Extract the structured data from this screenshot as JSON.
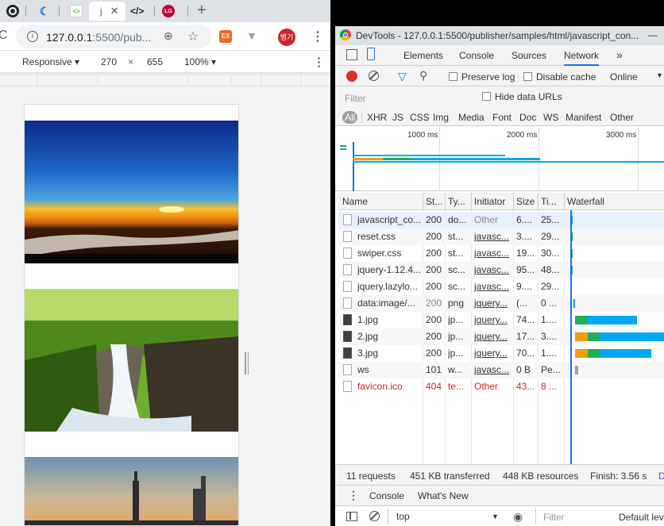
{
  "browser": {
    "tabs": [
      {
        "id": "github",
        "label": ""
      },
      {
        "id": "edge",
        "label": ""
      },
      {
        "id": "code",
        "label": ""
      },
      {
        "id": "active",
        "label": "j"
      },
      {
        "id": "devcode",
        "label": "</>"
      },
      {
        "id": "lg",
        "label": "LG"
      }
    ],
    "url_host": "127.0.0.1",
    "url_rest": ":5500/pub...",
    "profile_label": "병기",
    "ext_label": "EX"
  },
  "device_toolbar": {
    "mode": "Responsive",
    "width": "270",
    "times": "×",
    "height": "655",
    "zoom": "100%"
  },
  "devtools": {
    "title": "DevTools - 127.0.0.1:5500/publisher/samples/html/javascript_con...",
    "tabs": [
      "Elements",
      "Console",
      "Sources",
      "Network"
    ],
    "more": "»",
    "toolbar": {
      "preserve_log": "Preserve log",
      "disable_cache": "Disable cache",
      "throttle": "Online"
    },
    "filter_placeholder": "Filter",
    "hide_data_urls": "Hide data URLs",
    "types": [
      "All",
      "XHR",
      "JS",
      "CSS",
      "Img",
      "Media",
      "Font",
      "Doc",
      "WS",
      "Manifest",
      "Other"
    ],
    "overview_ticks": [
      "1000 ms",
      "2000 ms",
      "3000 ms"
    ],
    "columns": [
      "Name",
      "St...",
      "Ty...",
      "Initiator",
      "Size",
      "Ti...",
      "Waterfall"
    ],
    "rows": [
      {
        "name": "javascript_co...",
        "status": "200",
        "type": "do...",
        "initiator": "Other",
        "size": "6....",
        "time": "25..."
      },
      {
        "name": "reset.css",
        "status": "200",
        "type": "st...",
        "initiator": "javasc...",
        "size": "3....",
        "time": "29..."
      },
      {
        "name": "swiper.css",
        "status": "200",
        "type": "st...",
        "initiator": "javasc...",
        "size": "19...",
        "time": "30..."
      },
      {
        "name": "jquery-1.12.4...",
        "status": "200",
        "type": "sc...",
        "initiator": "javasc...",
        "size": "95...",
        "time": "48..."
      },
      {
        "name": "jquery.lazylo...",
        "status": "200",
        "type": "sc...",
        "initiator": "javasc...",
        "size": "9....",
        "time": "29..."
      },
      {
        "name": "data:image/...",
        "status": "200",
        "type": "png",
        "initiator": "jquery...",
        "size": "(...",
        "time": "0 ..."
      },
      {
        "name": "1.jpg",
        "status": "200",
        "type": "jp...",
        "initiator": "jquery...",
        "size": "74...",
        "time": "1...."
      },
      {
        "name": "2.jpg",
        "status": "200",
        "type": "jp...",
        "initiator": "jquery...",
        "size": "17...",
        "time": "3...."
      },
      {
        "name": "3.jpg",
        "status": "200",
        "type": "jp...",
        "initiator": "jquery...",
        "size": "70...",
        "time": "1...."
      },
      {
        "name": "ws",
        "status": "101",
        "type": "w...",
        "initiator": "javasc...",
        "size": "0 B",
        "time": "Pe..."
      },
      {
        "name": "favicon.ico",
        "status": "404",
        "type": "te...",
        "initiator": "Other",
        "size": "43...",
        "time": "8 ..."
      }
    ],
    "summary": {
      "requests": "11 requests",
      "transferred": "451 KB transferred",
      "resources": "448 KB resources",
      "finish": "Finish: 3.56 s",
      "more": "D"
    },
    "drawer_tabs": [
      "Console",
      "What's New"
    ],
    "console": {
      "context": "top",
      "filter_placeholder": "Filter",
      "levels": "Default lev"
    }
  },
  "colors": {
    "accent": "#1a73e8",
    "record": "#d93025",
    "waterfall_blue": "#03a9f4",
    "waterfall_green": "#1fae5c",
    "waterfall_orange": "#f49c12",
    "error": "#c62828"
  }
}
